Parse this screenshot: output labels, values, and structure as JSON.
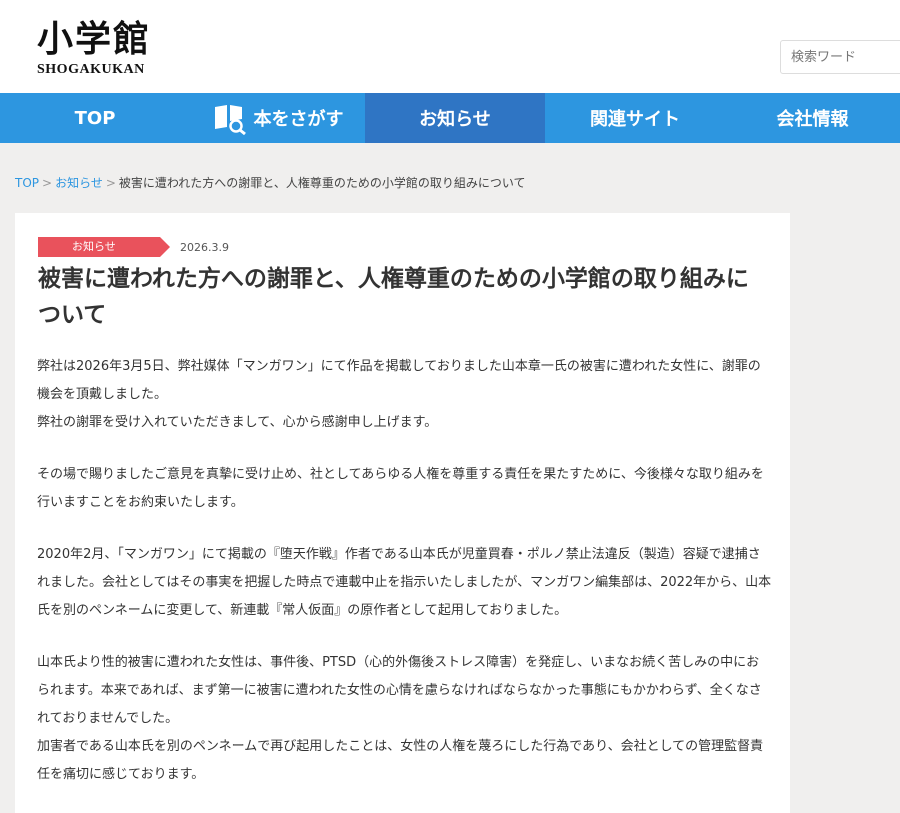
{
  "header": {
    "logo_kanji": "小学館",
    "logo_roman": "SHOGAKUKAN",
    "search_placeholder": "検索ワード"
  },
  "nav": {
    "items": [
      {
        "label": "TOP"
      },
      {
        "label": "本をさがす",
        "icon": "book-search-icon"
      },
      {
        "label": "お知らせ",
        "active": true
      },
      {
        "label": "関連サイト"
      },
      {
        "label": "会社情報"
      }
    ]
  },
  "breadcrumb": {
    "home": "TOP",
    "section": "お知らせ",
    "current": "被害に遭われた方への謝罪と、人権尊重のための小学館の取り組みについて"
  },
  "article": {
    "category": "お知らせ",
    "date": "2026.3.9",
    "title": "被害に遭われた方への謝罪と、人権尊重のための小学館の取り組みについて",
    "paragraphs": [
      "弊社は2026年3月5日、弊社媒体「マンガワン」にて作品を掲載しておりました山本章一氏の被害に遭われた女性に、謝罪の機会を頂戴しました。\n弊社の謝罪を受け入れていただきまして、心から感謝申し上げます。",
      "その場で賜りましたご意見を真摯に受け止め、社としてあらゆる人権を尊重する責任を果たすために、今後様々な取り組みを行いますことをお約束いたします。",
      "2020年2月、「マンガワン」にて掲載の『堕天作戦』作者である山本氏が児童買春・ポルノ禁止法違反（製造）容疑で逮捕されました。会社としてはその事実を把握した時点で連載中止を指示いたしましたが、マンガワン編集部は、2022年から、山本氏を別のペンネームに変更して、新連載『常人仮面』の原作者として起用しておりました。",
      "山本氏より性的被害に遭われた女性は、事件後、PTSD（心的外傷後ストレス障害）を発症し、いまなお続く苦しみの中におられます。本来であれば、まず第一に被害に遭われた女性の心情を慮らなければならなかった事態にもかかわらず、全くなされておりませんでした。\n加害者である山本氏を別のペンネームで再び起用したことは、女性の人権を蔑ろにした行為であり、会社としての管理監督責任を痛切に感じております。"
    ]
  },
  "colors": {
    "nav_bg": "#2d96e0",
    "nav_active": "#2f75c4",
    "tag_bg": "#e9525c",
    "page_bg": "#f0efee"
  }
}
